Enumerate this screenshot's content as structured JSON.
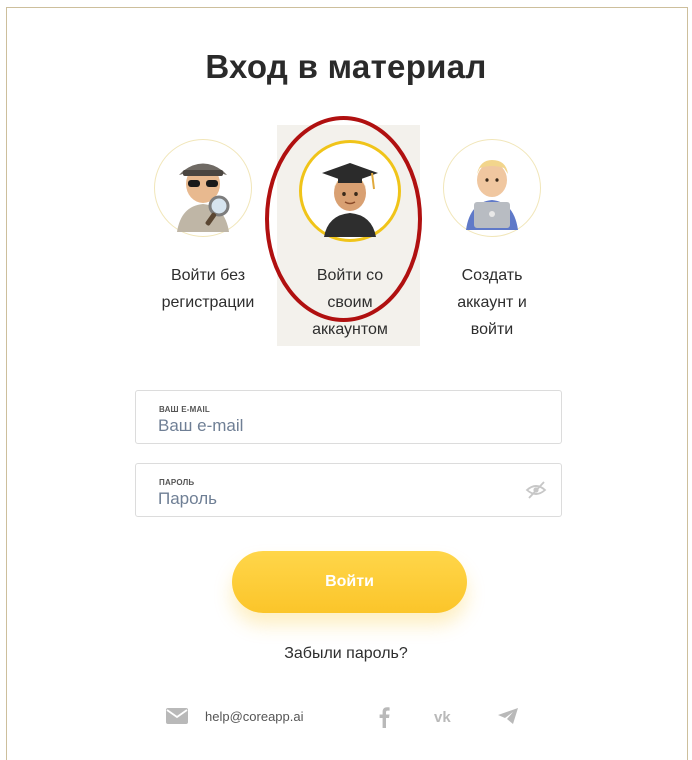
{
  "title": "Вход в материал",
  "options": [
    {
      "label_lines": [
        "Войти без",
        "регистрации"
      ],
      "icon": "spy-icon",
      "selected": false
    },
    {
      "label_lines": [
        "Войти со",
        "своим",
        "аккаунтом"
      ],
      "icon": "graduate-icon",
      "selected": true
    },
    {
      "label_lines": [
        "Создать",
        "аккаунт и",
        "войти"
      ],
      "icon": "laptop-user-icon",
      "selected": false
    }
  ],
  "email_field": {
    "label": "ВАШ E-MAIL",
    "placeholder": "Ваш e-mail",
    "value": ""
  },
  "password_field": {
    "label": "ПАРОЛЬ",
    "placeholder": "Пароль",
    "value": ""
  },
  "login_button": "Войти",
  "forgot_link": "Забыли пароль?",
  "footer": {
    "email": "help@coreapp.ai",
    "social_icons": [
      "facebook-icon",
      "vk-icon",
      "telegram-icon"
    ]
  },
  "colors": {
    "accent": "#fbc52a",
    "highlight_oval": "#b01010",
    "selected_bg": "#f3f1ec"
  }
}
